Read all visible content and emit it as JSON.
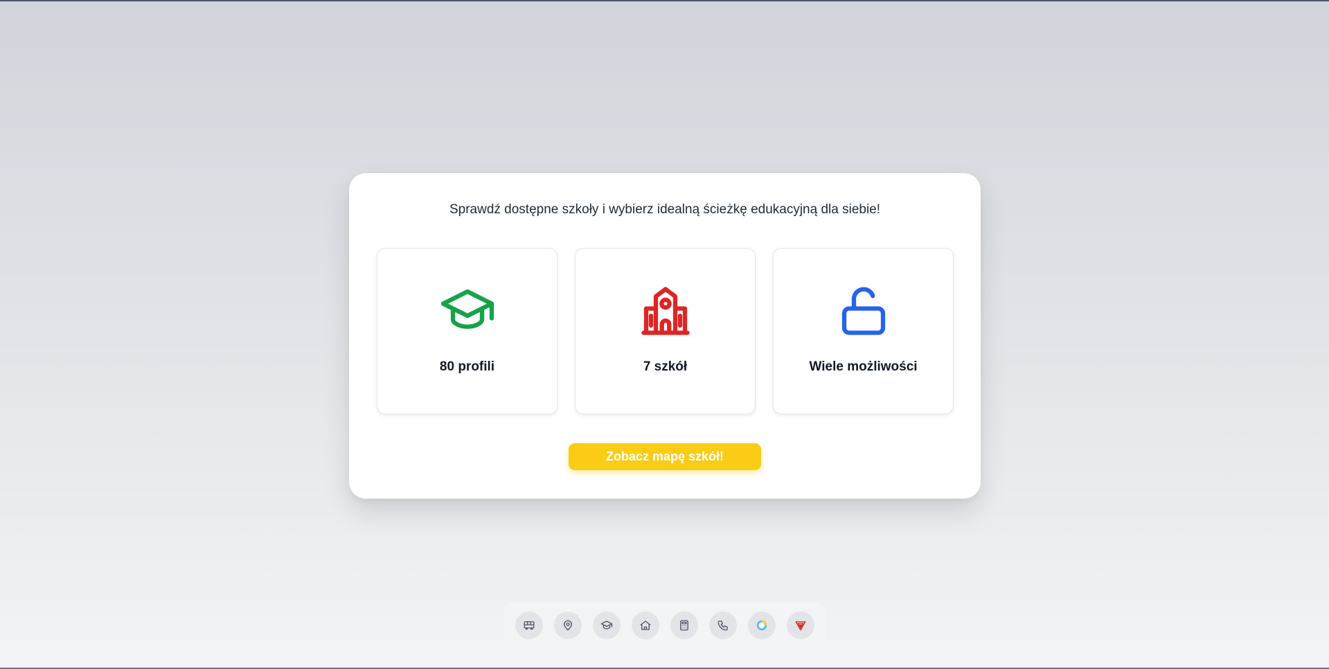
{
  "headline": "Sprawdź dostępne szkoły i wybierz idealną ścieżkę edukacyjną dla siebie!",
  "features": [
    {
      "label": "80 profili",
      "icon": "graduation-cap-icon",
      "color": "#16a34a"
    },
    {
      "label": "7 szkół",
      "icon": "school-building-icon",
      "color": "#dc2626"
    },
    {
      "label": "Wiele możliwości",
      "icon": "unlocked-padlock-icon",
      "color": "#2563eb"
    }
  ],
  "cta": {
    "label": "Zobacz mapę szkół!",
    "color": "#facc15"
  },
  "dock": {
    "items": [
      {
        "icon": "bus-icon"
      },
      {
        "icon": "map-pin-icon"
      },
      {
        "icon": "graduation-cap-icon"
      },
      {
        "icon": "home-icon"
      },
      {
        "icon": "calculator-icon"
      },
      {
        "icon": "phone-icon"
      },
      {
        "icon": "circle-logo-icon"
      },
      {
        "icon": "red-triangle-logo-icon"
      }
    ]
  }
}
